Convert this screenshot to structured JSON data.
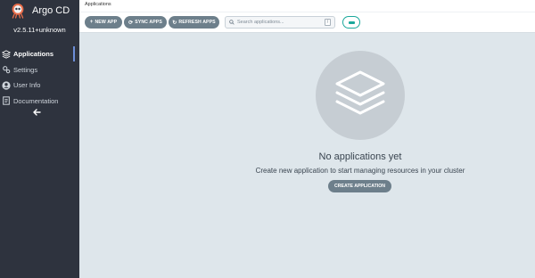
{
  "app": {
    "name": "Argo CD",
    "version": "v2.5.11+unknown",
    "collapse_icon": "arrow-left-icon"
  },
  "sidebar": {
    "items": [
      {
        "label": "Applications",
        "icon": "layers-icon",
        "active": true
      },
      {
        "label": "Settings",
        "icon": "gears-icon",
        "active": false
      },
      {
        "label": "User Info",
        "icon": "user-icon",
        "active": false
      },
      {
        "label": "Documentation",
        "icon": "book-icon",
        "active": false
      }
    ]
  },
  "header": {
    "breadcrumb": "Applications"
  },
  "toolbar": {
    "new_app_label": "NEW APP",
    "sync_apps_label": "SYNC APPS",
    "refresh_apps_label": "REFRESH APPS",
    "search_placeholder": "Search applications...",
    "search_shortcut": "/"
  },
  "empty_state": {
    "title": "No applications yet",
    "subtitle": "Create new application to start managing resources in your cluster",
    "create_label": "CREATE APPLICATION"
  },
  "colors": {
    "sidebar_bg": "#2e333e",
    "content_bg": "#dee6eb",
    "button_bg": "#6d7f8b",
    "accent_teal": "#1ba89c",
    "active_indicator": "#6c8ed8"
  }
}
